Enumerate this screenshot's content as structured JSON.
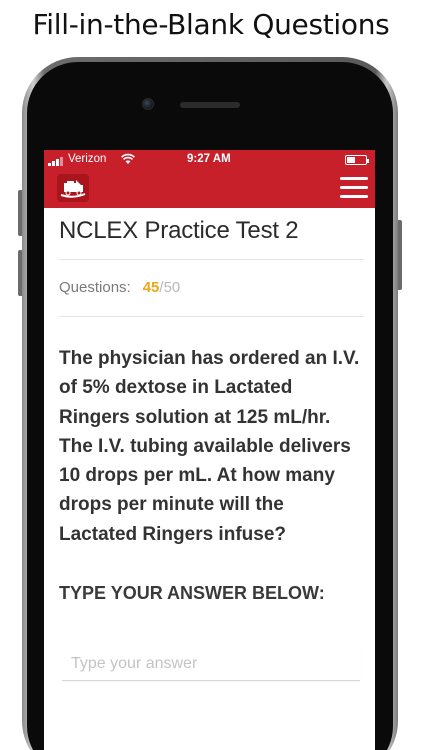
{
  "caption": "Fill-in-the-Blank Questions",
  "status_bar": {
    "carrier": "Verizon",
    "time": "9:27 AM"
  },
  "app_bar": {
    "logo_icon": "truck-logo-icon",
    "menu_icon": "hamburger-menu-icon",
    "color": "#c8202a"
  },
  "test": {
    "title": "NCLEX Practice Test 2",
    "questions_label": "Questions:",
    "current": "45",
    "total": "/50",
    "current_color": "#f0a417"
  },
  "question": {
    "text": "The physician has ordered an I.V. of 5% dextose in Lactated Ringers solution at 125 mL/hr. The I.V. tubing available delivers 10 drops per mL. At how many drops per minute will the Lactated Ringers infuse?",
    "answer_prompt": "TYPE YOUR ANSWER BELOW:",
    "answer_placeholder": "Type your answer",
    "answer_value": ""
  }
}
